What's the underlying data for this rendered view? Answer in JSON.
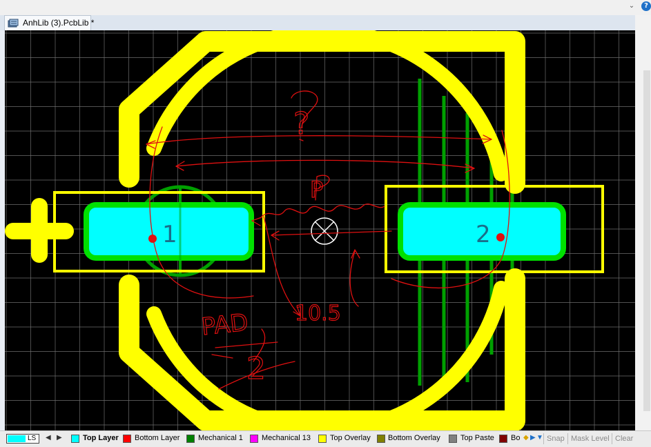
{
  "window": {
    "help_symbol": "?",
    "collapse_symbol": "⌄"
  },
  "tab": {
    "title": "AnhLib (3).PcbLib *"
  },
  "canvas": {
    "pads": [
      {
        "designator": "1"
      },
      {
        "designator": "2"
      }
    ],
    "annotations": [
      {
        "text": "?"
      },
      {
        "text": "P"
      },
      {
        "text": "10.5"
      },
      {
        "text": "PAD"
      },
      {
        "text": "2"
      }
    ]
  },
  "statusbar": {
    "ls_label": "LS",
    "layers": [
      {
        "label": "Top Layer",
        "color": "#00ffff",
        "active": true
      },
      {
        "label": "Bottom Layer",
        "color": "#ff0000"
      },
      {
        "label": "Mechanical 1",
        "color": "#008000"
      },
      {
        "label": "Mechanical 13",
        "color": "#ff00ff"
      },
      {
        "label": "Top Overlay",
        "color": "#ffff00"
      },
      {
        "label": "Bottom Overlay",
        "color": "#808000"
      },
      {
        "label": "Top Paste",
        "color": "#808080"
      },
      {
        "label": "Bo",
        "color": "#800000"
      }
    ],
    "snap_label": "Snap",
    "mask_level_label": "Mask Level",
    "clear_label": "Clear"
  },
  "colors": {
    "overlay": "#ffff00",
    "copper_top": "#00ffff",
    "mechanical": "#00a000",
    "grid": "#6e6e6e",
    "sketch": "#e01010"
  }
}
